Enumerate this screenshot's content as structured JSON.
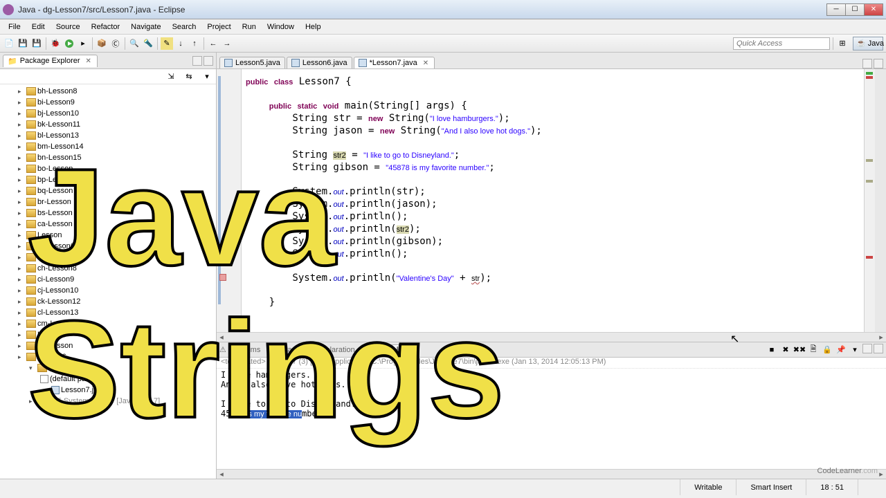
{
  "window": {
    "title": "Java - dg-Lesson7/src/Lesson7.java - Eclipse"
  },
  "menu": [
    "File",
    "Edit",
    "Source",
    "Refactor",
    "Navigate",
    "Search",
    "Project",
    "Run",
    "Window",
    "Help"
  ],
  "toolbar": {
    "quick_access_placeholder": "Quick Access",
    "perspective_label": "Java"
  },
  "explorer": {
    "title": "Package Explorer",
    "items": [
      "bh-Lesson8",
      "bi-Lesson9",
      "bj-Lesson10",
      "bk-Lesson11",
      "bl-Lesson13",
      "bm-Lesson14",
      "bn-Lesson15",
      "bo-Lesson",
      "bp-Lesson",
      "bq-Lesson",
      "br-Lesson",
      "bs-Lesson",
      "ca-Lesson",
      "Lesson",
      "cf-Lesson6",
      "cg-Lesson7",
      "ch-Lesson8",
      "ci-Lesson9",
      "cj-Lesson10",
      "ck-Lesson12",
      "cl-Lesson13",
      "cm-Lesson",
      "Lesson",
      "de-Lesson",
      "Lesson6"
    ],
    "package_label": "(default package)",
    "java_file": "Lesson7.java",
    "jre_label": "JRE System Library [JavaSE-1.7]"
  },
  "editor": {
    "tabs": [
      {
        "label": "Lesson5.java",
        "active": false
      },
      {
        "label": "Lesson6.java",
        "active": false
      },
      {
        "label": "*Lesson7.java",
        "active": true
      }
    ],
    "class_name": "Lesson7",
    "main_sig": "main(String[] args)",
    "str_lit1": "\"I love hamburgers.\"",
    "str_lit2": "\"And I also love hot dogs.\"",
    "str_lit3": "\"I like to go to Disneyland.\"",
    "str_lit4": "\"45878 is my favorite number.\"",
    "val_day": "\"Valentine's Day\"",
    "var_str2": "str2",
    "var_str_bad": "str"
  },
  "console": {
    "tabs": [
      "Problems",
      "Javadoc",
      "Declaration",
      "Console"
    ],
    "active": "Console",
    "header": "<terminated> Lesson7 (3) [Java Application] C:\\Program Files\\Java\\jre7\\bin\\javaw.exe (Jan 13, 2014 12:05:13 PM)",
    "out_line1": "I love hamburgers.",
    "out_line2": "And I also love hot dogs.",
    "out_line3": "",
    "out_line4_a": "I like to go to Disneyland.",
    "out_line5_a": "458",
    "out_line5_sel": "78 is my favorite nu",
    "out_line5_b": "mber."
  },
  "status": {
    "writable": "Writable",
    "insert": "Smart Insert",
    "pos": "18 : 51"
  },
  "overlay": {
    "java": "Java",
    "strings": "Strings",
    "watermark_a": "CodeLearner",
    "watermark_b": ".com"
  },
  "chart_data": {
    "type": "table",
    "note": "no chart in image"
  }
}
